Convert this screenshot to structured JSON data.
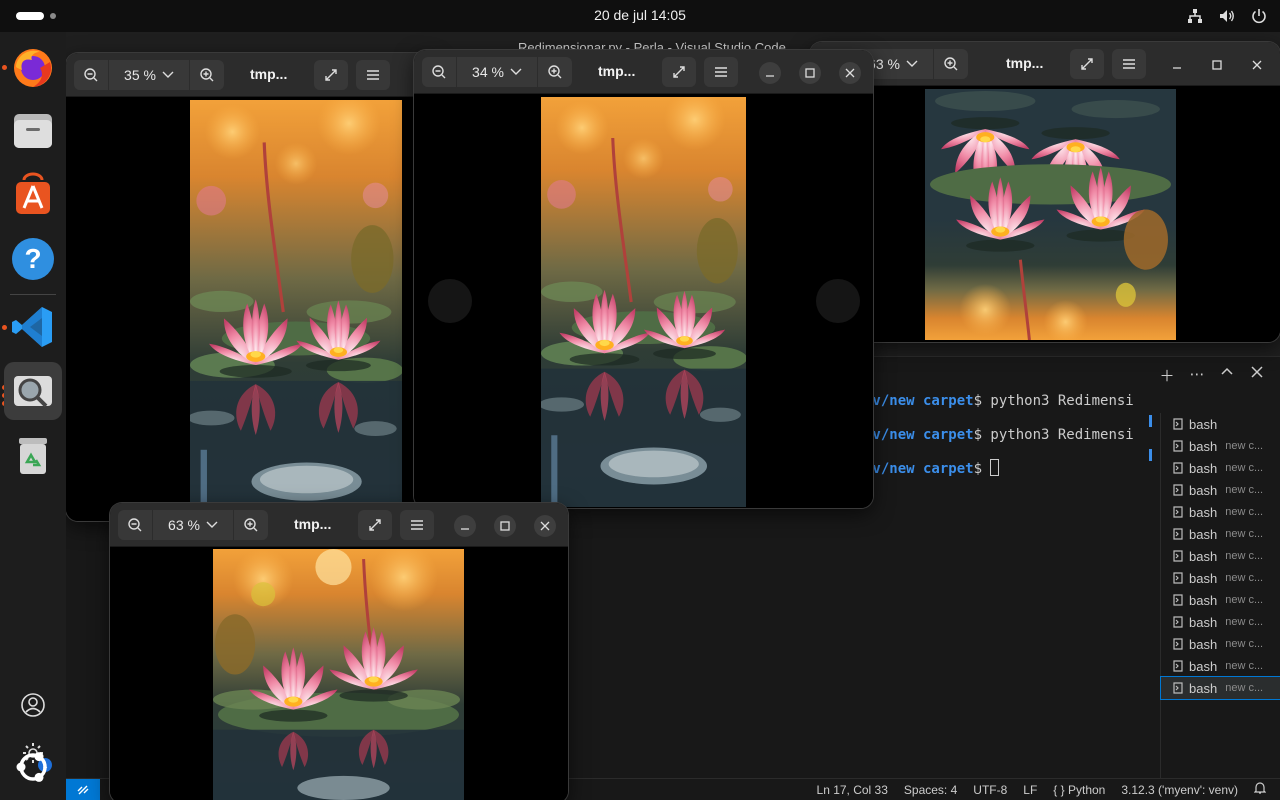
{
  "topbar": {
    "clock": "20 de jul  14:05",
    "tray": [
      "network-icon",
      "volume-icon",
      "power-icon"
    ]
  },
  "dock": {
    "apps": [
      "firefox",
      "files",
      "app-center",
      "help",
      "visual-studio-code",
      "image-viewer",
      "trash"
    ],
    "settings_badge": "1"
  },
  "vscode": {
    "title": "Redimensionar.py - Perla - Visual Studio Code",
    "terminal": {
      "lines": [
        {
          "path": "nv/new carpet",
          "suffix": "$ python3 Redimensi"
        },
        {
          "path": "nv/new carpet",
          "suffix": "$ python3 Redimensi"
        },
        {
          "path": "nv/new carpet",
          "suffix": "$ "
        }
      ],
      "instances": [
        {
          "name": "bash",
          "sub": ""
        },
        {
          "name": "bash",
          "sub": "new c..."
        },
        {
          "name": "bash",
          "sub": "new c..."
        },
        {
          "name": "bash",
          "sub": "new c..."
        },
        {
          "name": "bash",
          "sub": "new c..."
        },
        {
          "name": "bash",
          "sub": "new c..."
        },
        {
          "name": "bash",
          "sub": "new c..."
        },
        {
          "name": "bash",
          "sub": "new c..."
        },
        {
          "name": "bash",
          "sub": "new c..."
        },
        {
          "name": "bash",
          "sub": "new c..."
        },
        {
          "name": "bash",
          "sub": "new c..."
        },
        {
          "name": "bash",
          "sub": "new c..."
        },
        {
          "name": "bash",
          "sub": "new c..."
        }
      ],
      "selected_index": 12
    },
    "statusbar": {
      "position": "Ln 17, Col 33",
      "spaces": "Spaces: 4",
      "encoding": "UTF-8",
      "eol": "LF",
      "language": "Python",
      "interpreter": "3.12.3 ('myenv': venv)"
    }
  },
  "viewers": [
    {
      "zoom": "35 %",
      "title": "tmp..."
    },
    {
      "zoom": "34 %",
      "title": "tmp..."
    },
    {
      "zoom": "63 %",
      "title": "tmp..."
    },
    {
      "zoom": "63 %",
      "title": "tmp..."
    }
  ],
  "colors": {
    "accent_vscode": "#0078d4",
    "terminal_path": "#3b8eea",
    "ubuntu_orange": "#e95420",
    "viewer_headerbar": "#2c2c2c"
  }
}
